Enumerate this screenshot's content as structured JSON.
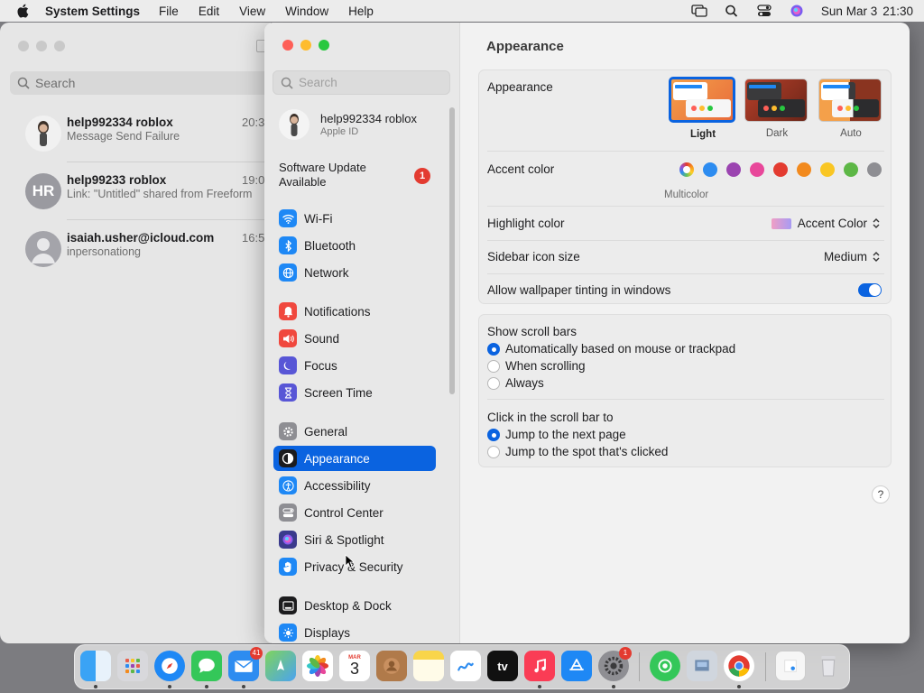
{
  "menubar": {
    "app_name": "System Settings",
    "items": [
      "File",
      "Edit",
      "View",
      "Window",
      "Help"
    ],
    "date": "Sun Mar 3",
    "time": "21:30"
  },
  "messages": {
    "search_placeholder": "Search",
    "conversations": [
      {
        "name": "help992334 roblox",
        "time": "20:3",
        "preview": "Message Send Failure",
        "initials": ""
      },
      {
        "name": "help99233 roblox",
        "time": "19:0",
        "preview": "Link: \"Untitled\" shared from Freeform",
        "initials": "HR"
      },
      {
        "name": "isaiah.usher@icloud.com",
        "time": "16:5",
        "preview": "inpersonationg",
        "initials": ""
      }
    ]
  },
  "sidebar": {
    "search_placeholder": "Search",
    "profile": {
      "name": "help992334 roblox",
      "subtitle": "Apple ID"
    },
    "update": {
      "label": "Software Update Available",
      "badge": "1"
    },
    "items": [
      {
        "label": "Wi-Fi",
        "color": "#1e88f5"
      },
      {
        "label": "Bluetooth",
        "color": "#1e88f5"
      },
      {
        "label": "Network",
        "color": "#1e88f5"
      },
      {
        "label": "Notifications",
        "color": "#f0483e"
      },
      {
        "label": "Sound",
        "color": "#f0483e"
      },
      {
        "label": "Focus",
        "color": "#5856d6"
      },
      {
        "label": "Screen Time",
        "color": "#5856d6"
      },
      {
        "label": "General",
        "color": "#8e8e93"
      },
      {
        "label": "Appearance",
        "color": "#1c1c1e"
      },
      {
        "label": "Accessibility",
        "color": "#1e88f5"
      },
      {
        "label": "Control Center",
        "color": "#8e8e93"
      },
      {
        "label": "Siri & Spotlight",
        "color": "#3a3a8c"
      },
      {
        "label": "Privacy & Security",
        "color": "#1e88f5"
      },
      {
        "label": "Desktop & Dock",
        "color": "#1c1c1e"
      },
      {
        "label": "Displays",
        "color": "#1e88f5"
      }
    ]
  },
  "content": {
    "title": "Appearance",
    "appearance": {
      "label": "Appearance",
      "options": [
        "Light",
        "Dark",
        "Auto"
      ],
      "selected": "Light"
    },
    "accent": {
      "label": "Accent color",
      "selected_label": "Multicolor",
      "colors": [
        "#2d8cf0",
        "#9b44b0",
        "#e8479a",
        "#e33b30",
        "#f28a1e",
        "#f9c623",
        "#5db746",
        "#8e8e93"
      ]
    },
    "highlight": {
      "label": "Highlight color",
      "value": "Accent Color"
    },
    "sidebar_icon": {
      "label": "Sidebar icon size",
      "value": "Medium"
    },
    "tinting": {
      "label": "Allow wallpaper tinting in windows",
      "on": true
    },
    "scroll_bars": {
      "label": "Show scroll bars",
      "options": [
        "Automatically based on mouse or trackpad",
        "When scrolling",
        "Always"
      ],
      "selected": 0
    },
    "click_scroll": {
      "label": "Click in the scroll bar to",
      "options": [
        "Jump to the next page",
        "Jump to the spot that's clicked"
      ],
      "selected": 0
    },
    "help": "?"
  },
  "dock": {
    "mail_badge": "41",
    "calendar_month": "MAR",
    "calendar_day": "3",
    "tv_label": "tv",
    "settings_badge": "1",
    "apps": [
      "finder",
      "launchpad",
      "safari",
      "messages",
      "mail",
      "maps",
      "photos",
      "calendar",
      "contacts",
      "notes",
      "freeform",
      "tv",
      "music",
      "app-store",
      "system-settings",
      "find-my",
      "preview",
      "chrome",
      "document",
      "trash"
    ]
  }
}
